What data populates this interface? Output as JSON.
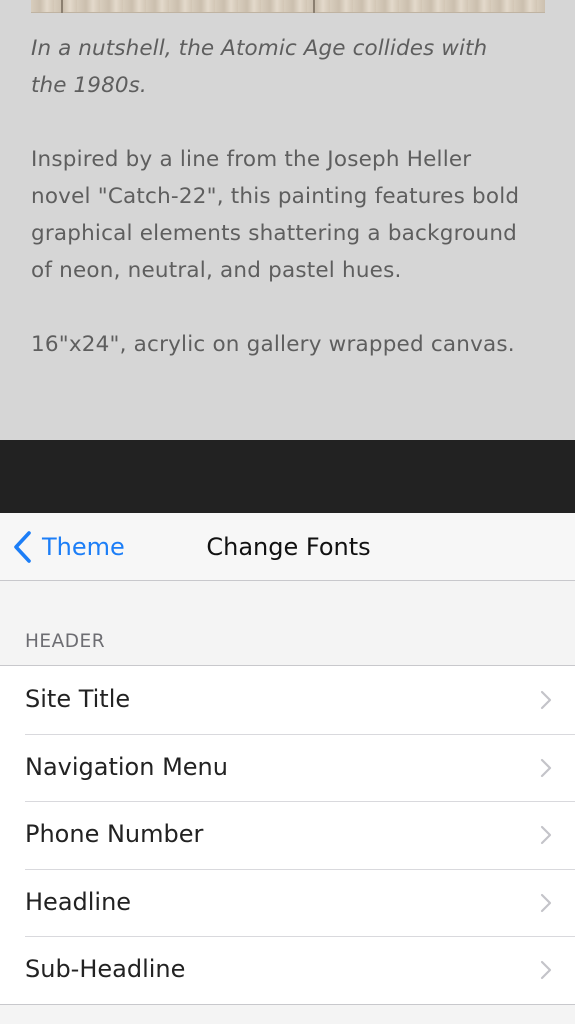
{
  "preview": {
    "image_alt": "wood-plank-image",
    "tagline_lines": [
      "In a nutshell, the Atomic Age collides with",
      "the 1980s."
    ],
    "description_lines": [
      "Inspired by a line from the Joseph Heller",
      "novel \"Catch-22\", this painting features bold",
      "graphical elements shattering a background",
      "of neon, neutral, and pastel hues."
    ],
    "specs": "16\"x24\", acrylic on gallery wrapped canvas."
  },
  "navbar": {
    "back_label": "Theme",
    "back_icon": "chevron-left-icon",
    "title": "Change Fonts"
  },
  "section": {
    "header": "HEADER",
    "items": [
      {
        "label": "Site Title",
        "icon": "chevron-right-icon"
      },
      {
        "label": "Navigation Menu",
        "icon": "chevron-right-icon"
      },
      {
        "label": "Phone Number",
        "icon": "chevron-right-icon"
      },
      {
        "label": "Headline",
        "icon": "chevron-right-icon"
      },
      {
        "label": "Sub-Headline",
        "icon": "chevron-right-icon"
      }
    ]
  },
  "colors": {
    "accent": "#1c7ef7",
    "preview_bg": "#d6d6d6",
    "dark_band": "#222222"
  }
}
